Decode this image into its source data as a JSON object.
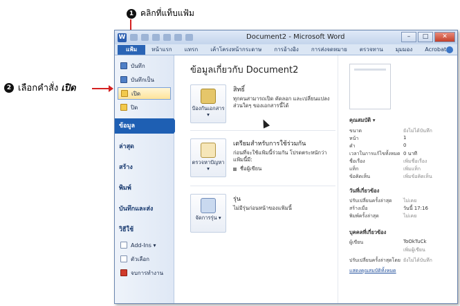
{
  "annotations": {
    "step1_number": "1",
    "step1_text": "คลิกที่แท็บแฟ้ม",
    "step2_number": "2",
    "step2_text": "เลือกคำสั่ง",
    "step2_emphasis": "เปิด"
  },
  "window": {
    "title": "Document2 - Microsoft Word",
    "app_icon_label": "W",
    "buttons": {
      "minimize": "–",
      "maximize": "□",
      "close": "✕"
    }
  },
  "ribbon_tabs": [
    "แฟ้ม",
    "หน้าแรก",
    "แทรก",
    "เค้าโครงหน้ากระดาษ",
    "การอ้างอิง",
    "การส่งจดหมาย",
    "ตรวจทาน",
    "มุมมอง",
    "Acrobat"
  ],
  "sidebar": {
    "small_items": [
      {
        "label": "บันทึก"
      },
      {
        "label": "บันทึกเป็น"
      },
      {
        "label": "เปิด"
      },
      {
        "label": "ปิด"
      }
    ],
    "sections": [
      "ข้อมูล",
      "ล่าสุด",
      "สร้าง",
      "พิมพ์",
      "บันทึกและส่ง",
      "วิธีใช้"
    ],
    "bottom_items": [
      {
        "label": "Add-Ins ▾"
      },
      {
        "label": "ตัวเลือก"
      },
      {
        "label": "จบการทำงาน"
      }
    ]
  },
  "main": {
    "title": "ข้อมูลเกี่ยวกับ Document2",
    "permissions": {
      "button_label": "ป้องกันเอกสาร ▾",
      "heading": "สิทธิ์",
      "desc": "ทุกคนสามารถเปิด คัดลอก และเปลี่ยนแปลงส่วนใดๆ ของเอกสารนี้ได้"
    },
    "prepare": {
      "button_label": "ตรวจหาปัญหา ▾",
      "heading": "เตรียมสำหรับการใช้ร่วมกัน",
      "desc": "ก่อนที่จะใช้แฟ้มนี้ร่วมกัน โปรดตระหนักว่าแฟ้มนี้มี:",
      "bullet": "ชื่อผู้เขียน"
    },
    "versions": {
      "button_label": "จัดการรุ่น ▾",
      "heading": "รุ่น",
      "desc": "ไม่มีรุ่นก่อนหน้าของแฟ้มนี้"
    }
  },
  "properties": {
    "heading": "คุณสมบัติ ▾",
    "rows": [
      {
        "key": "ขนาด",
        "value": "ยังไม่ได้บันทึก"
      },
      {
        "key": "หน้า",
        "value": "1"
      },
      {
        "key": "คำ",
        "value": "0"
      },
      {
        "key": "เวลาในการแก้ไขทั้งหมด",
        "value": "0 นาที"
      },
      {
        "key": "ชื่อเรื่อง",
        "value": "เพิ่มชื่อเรื่อง"
      },
      {
        "key": "แท็ก",
        "value": "เพิ่มแท็ก"
      },
      {
        "key": "ข้อคิดเห็น",
        "value": "เพิ่มข้อคิดเห็น"
      }
    ],
    "dates_heading": "วันที่เกี่ยวข้อง",
    "dates": [
      {
        "key": "ปรับเปลี่ยนครั้งล่าสุด",
        "value": "ไม่เคย"
      },
      {
        "key": "สร้างเมื่อ",
        "value": "วันนี้ 17:16"
      },
      {
        "key": "พิมพ์ครั้งล่าสุด",
        "value": "ไม่เคย"
      }
    ],
    "people_heading": "บุคคลที่เกี่ยวข้อง",
    "author_key": "ผู้เขียน",
    "author_value": "ToOkTuCk",
    "add_author": "เพิ่มผู้เขียน",
    "modified_by_key": "ปรับเปลี่ยนครั้งล่าสุดโดย",
    "modified_by_value": "ยังไม่ได้บันทึก",
    "show_all": "แสดงคุณสมบัติทั้งหมด"
  }
}
